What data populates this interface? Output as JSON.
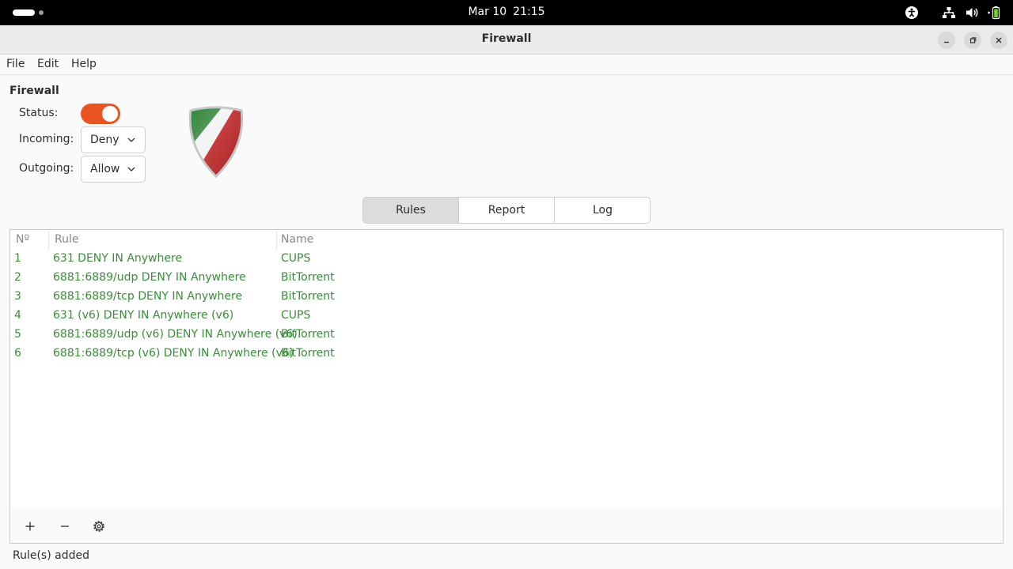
{
  "topbar": {
    "date": "Mar 10",
    "time": "21:15",
    "icons": [
      "accessibility-icon",
      "network-icon",
      "volume-icon",
      "battery-icon"
    ]
  },
  "window": {
    "title": "Firewall"
  },
  "menu": {
    "file": "File",
    "edit": "Edit",
    "help": "Help"
  },
  "firewall": {
    "section_title": "Firewall",
    "status_label": "Status:",
    "status_on": true,
    "incoming_label": "Incoming:",
    "incoming_value": "Deny",
    "outgoing_label": "Outgoing:",
    "outgoing_value": "Allow"
  },
  "tabs": [
    {
      "label": "Rules",
      "active": true
    },
    {
      "label": "Report",
      "active": false
    },
    {
      "label": "Log",
      "active": false
    }
  ],
  "table": {
    "headers": {
      "number": "Nº",
      "rule": "Rule",
      "name": "Name"
    },
    "rows": [
      {
        "number": "1",
        "rule": "631 DENY IN Anywhere",
        "name": "CUPS"
      },
      {
        "number": "2",
        "rule": "6881:6889/udp DENY IN Anywhere",
        "name": "BitTorrent"
      },
      {
        "number": "3",
        "rule": "6881:6889/tcp DENY IN Anywhere",
        "name": "BitTorrent"
      },
      {
        "number": "4",
        "rule": "631 (v6) DENY IN Anywhere (v6)",
        "name": "CUPS"
      },
      {
        "number": "5",
        "rule": "6881:6889/udp (v6) DENY IN Anywhere (v6)",
        "name": "BitTorrent"
      },
      {
        "number": "6",
        "rule": "6881:6889/tcp (v6) DENY IN Anywhere (v6)",
        "name": "BitTorrent"
      }
    ]
  },
  "toolbar": {
    "add_icon": "plus-icon",
    "remove_icon": "minus-icon",
    "settings_icon": "gear-icon"
  },
  "statusbar": {
    "text": "Rule(s) added"
  },
  "colors": {
    "accent": "#e95420",
    "rule_text": "#3c8c3c"
  }
}
